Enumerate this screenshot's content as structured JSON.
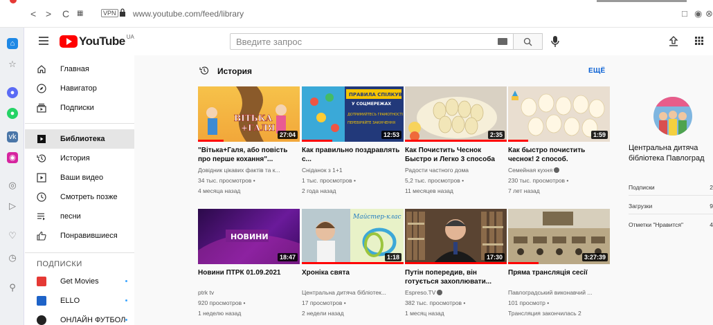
{
  "browser": {
    "url": "www.youtube.com/feed/library",
    "vpn": "VPN"
  },
  "header": {
    "logo_text": "YouTube",
    "region": "UA",
    "search_placeholder": "Введите запрос"
  },
  "guide": {
    "items": [
      {
        "label": "Главная",
        "icon": "home-icon"
      },
      {
        "label": "Навигатор",
        "icon": "compass-icon"
      },
      {
        "label": "Подписки",
        "icon": "subscriptions-icon"
      },
      {
        "label": "Библиотека",
        "icon": "library-icon",
        "active": true
      },
      {
        "label": "История",
        "icon": "history-icon"
      },
      {
        "label": "Ваши видео",
        "icon": "your-videos-icon"
      },
      {
        "label": "Смотреть позже",
        "icon": "watch-later-icon"
      },
      {
        "label": "песни",
        "icon": "playlist-icon"
      },
      {
        "label": "Понравившиеся",
        "icon": "like-icon"
      }
    ],
    "section_title": "ПОДПИСКИ",
    "subscriptions": [
      {
        "label": "Get Movies",
        "color": "#e53935"
      },
      {
        "label": "ELLO",
        "color": "#1e63c8"
      },
      {
        "label": "ОНЛАЙН ФУТБОЛ",
        "color": "#222222"
      }
    ]
  },
  "history": {
    "title": "История",
    "more": "ЕЩЁ",
    "videos": [
      {
        "title": "\"Вітька+Галя, або повість про перше кохання\"...",
        "channel": "Довідник цікавих фактів та к...",
        "views": "34 тыс. просмотров •",
        "age": "4 месяца назад",
        "duration": "27:04",
        "progress": 0.25,
        "verified": false
      },
      {
        "title": "Как правильно поздравлять с...",
        "channel": "Сніданок з 1+1",
        "views": "1 тыс. просмотров •",
        "age": "2 года назад",
        "duration": "12:53",
        "progress": 0.3,
        "verified": false
      },
      {
        "title": "Как Почистить Чеснок Быстро и Легко 3 способа",
        "channel": "Радости частного дома",
        "views": "5,2 тыс. просмотров •",
        "age": "11 месяцев назад",
        "duration": "2:35",
        "progress": 1.0,
        "verified": false
      },
      {
        "title": "Как быстро почистить чеснок! 2 способ.",
        "channel": "Семейная кухня",
        "views": "230 тыс. просмотров •",
        "age": "7 лет назад",
        "duration": "1:59",
        "progress": 0.2,
        "verified": true
      },
      {
        "title": "Новини ПТРК 01.09.2021",
        "channel": "ptrk tv",
        "views": "920 просмотров •",
        "age": "1 неделю назад",
        "duration": "18:47",
        "progress": 0.0,
        "verified": false
      },
      {
        "title": "Хроніка свята",
        "channel": "Центральна дитяча бібліотек...",
        "views": "17 просмотров •",
        "age": "2 недели назад",
        "duration": "1:18",
        "progress": 1.0,
        "verified": false
      },
      {
        "title": "Путін попередив, він готується захоплювати...",
        "channel": "Espreso.TV",
        "views": "382 тыс. просмотров •",
        "age": "1 месяц назад",
        "duration": "17:30",
        "progress": 1.0,
        "verified": true
      },
      {
        "title": "Пряма трансляція сесії",
        "channel": "Павлоградський виконавчий ...",
        "views": "101 просмотр •",
        "age": "Трансляция закончилась 2",
        "duration": "3:27:39",
        "progress": 0.3,
        "verified": false
      }
    ]
  },
  "channel_panel": {
    "name": "Центральна дитяча бібліотека Павлоград",
    "stats": [
      {
        "label": "Подписки",
        "value": "2"
      },
      {
        "label": "Загрузки",
        "value": "9"
      },
      {
        "label": "Отметки \"Нравится\"",
        "value": "4"
      }
    ]
  }
}
